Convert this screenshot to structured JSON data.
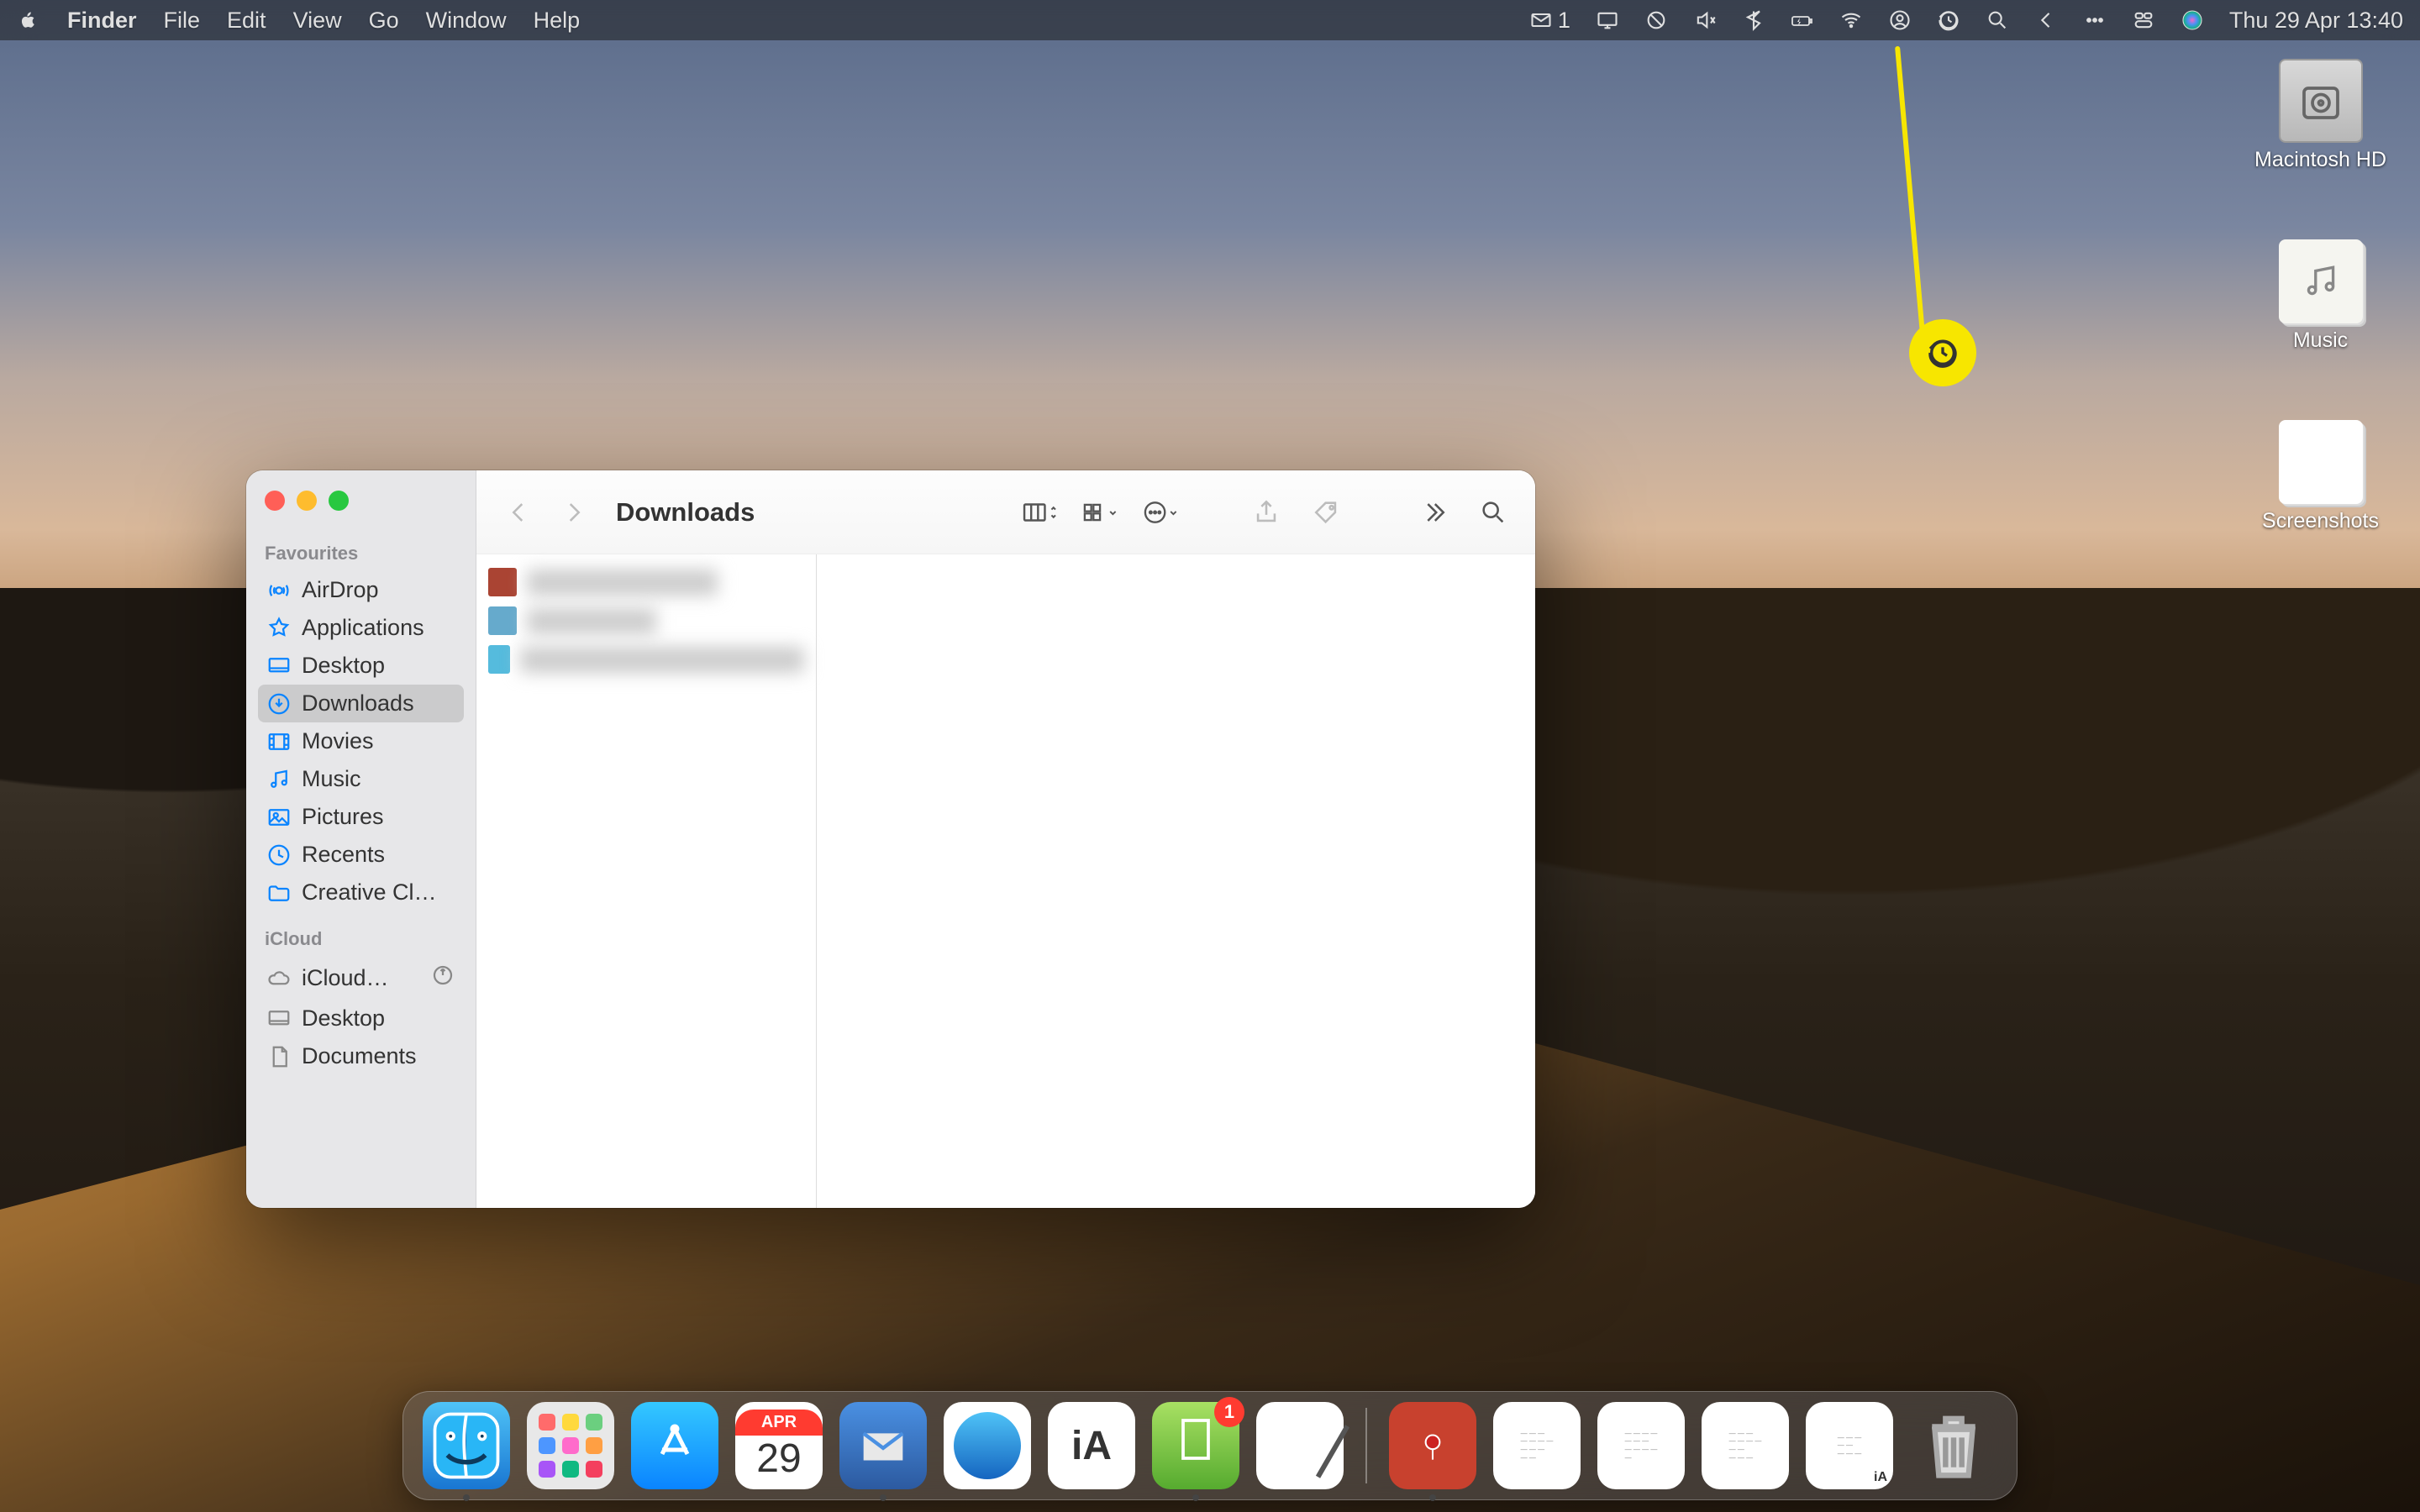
{
  "menubar": {
    "app": "Finder",
    "menus": [
      "File",
      "Edit",
      "View",
      "Go",
      "Window",
      "Help"
    ],
    "mail_badge": "1",
    "datetime": "Thu 29 Apr  13:40"
  },
  "desktop": {
    "icons": [
      {
        "name": "Macintosh HD"
      },
      {
        "name": "Music"
      },
      {
        "name": "Screenshots"
      }
    ]
  },
  "annotation": {
    "target": "time-machine-menu-icon"
  },
  "finder": {
    "title": "Downloads",
    "sidebar": {
      "favourites_label": "Favourites",
      "favourites": [
        {
          "label": "AirDrop",
          "icon": "airdrop"
        },
        {
          "label": "Applications",
          "icon": "apps"
        },
        {
          "label": "Desktop",
          "icon": "desktop"
        },
        {
          "label": "Downloads",
          "icon": "download",
          "selected": true
        },
        {
          "label": "Movies",
          "icon": "movies"
        },
        {
          "label": "Music",
          "icon": "music"
        },
        {
          "label": "Pictures",
          "icon": "pictures"
        },
        {
          "label": "Recents",
          "icon": "recents"
        },
        {
          "label": "Creative Cl…",
          "icon": "folder"
        }
      ],
      "icloud_label": "iCloud",
      "icloud": [
        {
          "label": "iCloud…",
          "icon": "cloud",
          "has_tm": true
        },
        {
          "label": "Desktop",
          "icon": "desktop"
        },
        {
          "label": "Documents",
          "icon": "documents"
        }
      ]
    },
    "files": [
      {
        "label": "████████"
      },
      {
        "label": "████"
      },
      {
        "label": "██████████████"
      }
    ]
  },
  "calendar": {
    "month": "APR",
    "day": "29"
  },
  "dock": {
    "badge": "1",
    "items": [
      "finder",
      "launchpad",
      "appstore",
      "calendar",
      "mail",
      "safari",
      "ia",
      "green",
      "notes"
    ],
    "recents": [
      "tile",
      "doc",
      "doc",
      "doc",
      "doc"
    ],
    "trash": "trash"
  }
}
